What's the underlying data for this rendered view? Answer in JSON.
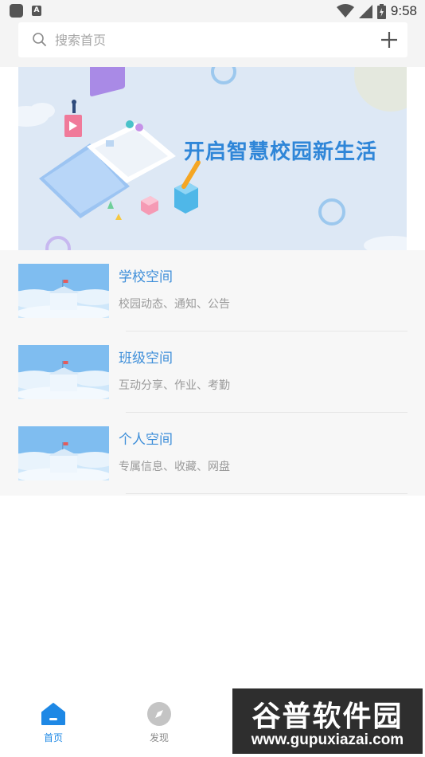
{
  "status_bar": {
    "time": "9:58",
    "notification_letter": "A"
  },
  "search": {
    "placeholder": "搜索首页"
  },
  "banner": {
    "title": "开启智慧校园新生活"
  },
  "list": [
    {
      "title": "学校空间",
      "subtitle": "校园动态、通知、公告"
    },
    {
      "title": "班级空间",
      "subtitle": "互动分享、作业、考勤"
    },
    {
      "title": "个人空间",
      "subtitle": "专属信息、收藏、网盘"
    }
  ],
  "tabs": [
    {
      "label": "首页",
      "icon": "home-icon",
      "active": true
    },
    {
      "label": "发现",
      "icon": "compass-icon",
      "active": false
    }
  ],
  "watermark": {
    "top": "谷普软件园",
    "bottom": "www.gupuxiazai.com"
  },
  "colors": {
    "accent": "#1e88e5",
    "title_blue": "#3d8ed9",
    "banner_bg": "#dde8f5"
  }
}
